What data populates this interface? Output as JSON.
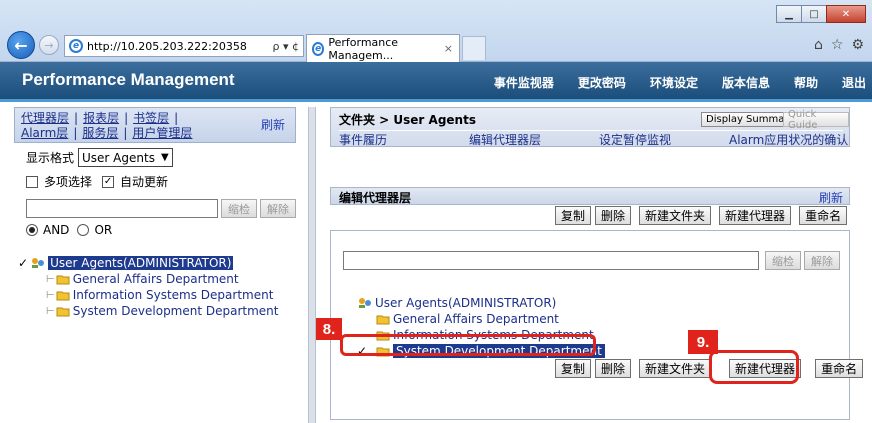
{
  "browser": {
    "address": "http://10.205.203.222:20358",
    "address_tools": "ρ ▾ ¢",
    "tab_title": "Performance Managem...",
    "tab_close": "×"
  },
  "app": {
    "title": "Performance Management",
    "nav": [
      "事件监视器",
      "更改密码",
      "环境设定",
      "版本信息",
      "帮助",
      "退出"
    ]
  },
  "left": {
    "tabs_row1": [
      "代理器层",
      "报表层",
      "书签层"
    ],
    "tabs_row2": [
      "Alarm层",
      "服务层",
      "用户管理层"
    ],
    "refresh": "刷新",
    "format_label": "显示格式",
    "format_value": "User Agents",
    "multi_select": "多项选择",
    "auto_update": "自动更新",
    "search_btn": "缩检",
    "clear_btn": "解除",
    "and_label": "AND",
    "or_label": "OR",
    "tree_root": "User Agents(ADMINISTRATOR)",
    "tree_items": [
      "General Affairs Department",
      "Information Systems Department",
      "System Development Department"
    ]
  },
  "right": {
    "folder_path": "文件夹 > User Agents",
    "display_summary": "Display Summary",
    "quick_guide": "Quick Guide",
    "links": [
      "事件履历",
      "编辑代理器层",
      "设定暂停监视",
      "Alarm应用状况的确认"
    ],
    "section_title": "编辑代理器层",
    "section_refresh": "刷新",
    "actions": [
      "复制",
      "删除",
      "新建文件夹",
      "新建代理器",
      "重命名"
    ],
    "search_btn": "缩检",
    "clear_btn": "解除",
    "tree_root": "User Agents(ADMINISTRATOR)",
    "tree_items": [
      "General Affairs Department",
      "Information Systems Department",
      "System Development Department"
    ]
  },
  "annotations": {
    "step8": "8.",
    "step9": "9."
  },
  "colors": {
    "header": "#1c4e7c",
    "accent": "#4c9ad6",
    "highlight": "#e0241b",
    "selected": "#1e3a8f"
  }
}
